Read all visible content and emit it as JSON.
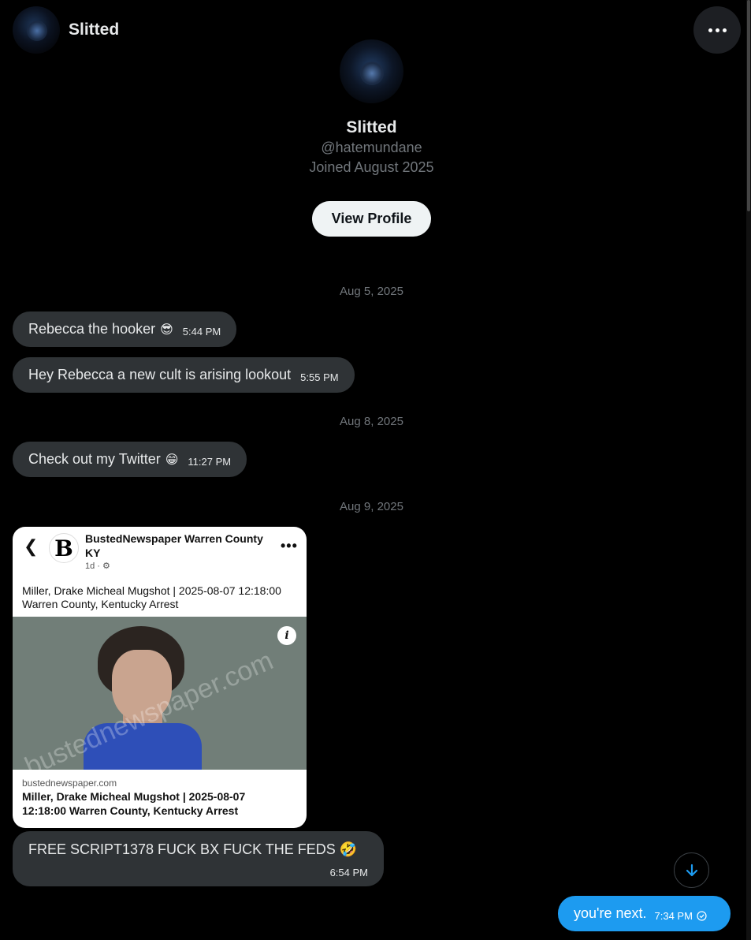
{
  "header": {
    "name": "Slitted",
    "more_icon": "more-horizontal-icon"
  },
  "profile": {
    "name": "Slitted",
    "handle": "@hatemundane",
    "joined": "Joined August 2025",
    "view_profile_label": "View Profile"
  },
  "messages": {
    "date1": "Aug 5, 2025",
    "m1": {
      "text": "Rebecca the hooker",
      "emoji": "😎",
      "time": "5:44 PM"
    },
    "m2": {
      "text": "Hey Rebecca a new cult is arising lookout",
      "time": "5:55 PM"
    },
    "date2": "Aug 8, 2025",
    "m3": {
      "text": "Check out my Twitter",
      "emoji": "😁",
      "time": "11:27 PM"
    },
    "date3": "Aug 9, 2025",
    "card": {
      "source_name": "BustedNewspaper Warren County KY",
      "meta": "1d ·",
      "logo_letter": "B",
      "headline": "Miller, Drake Micheal Mugshot | 2025-08-07 12:18:00 Warren County, Kentucky Arrest",
      "watermark": "bustednewspaper.com",
      "info_glyph": "i",
      "domain": "bustednewspaper.com",
      "link_title": "Miller, Drake Micheal Mugshot | 2025-08-07 12:18:00 Warren County, Kentucky Arrest"
    },
    "m4": {
      "text": "FREE SCRIPT1378 FUCK BX FUCK THE FEDS",
      "emoji": "🤣",
      "time": "6:54 PM"
    },
    "m5": {
      "text": "you're next.",
      "time": "7:34 PM"
    }
  },
  "colors": {
    "background": "#000000",
    "incoming_bubble": "#2f3336",
    "outgoing_bubble": "#1d9bf0",
    "muted_text": "#71767b"
  }
}
